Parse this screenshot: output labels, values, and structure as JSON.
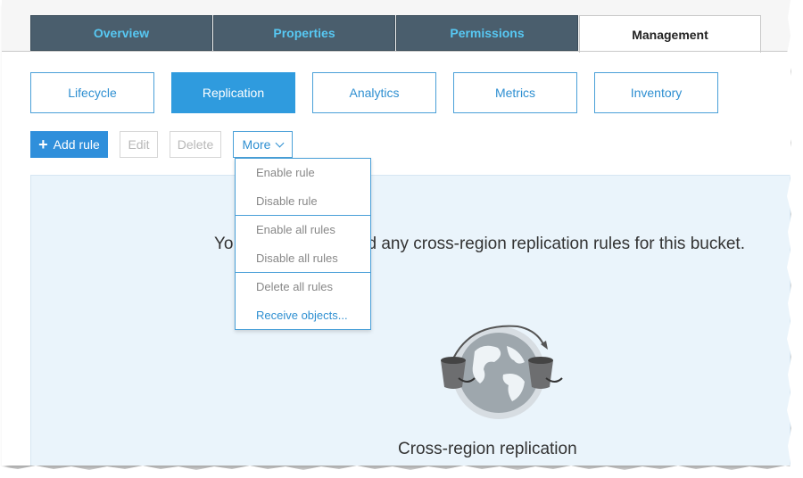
{
  "tabs": [
    {
      "label": "Overview"
    },
    {
      "label": "Properties"
    },
    {
      "label": "Permissions"
    },
    {
      "label": "Management"
    }
  ],
  "active_tab": "Management",
  "subtabs": [
    {
      "label": "Lifecycle"
    },
    {
      "label": "Replication"
    },
    {
      "label": "Analytics"
    },
    {
      "label": "Metrics"
    },
    {
      "label": "Inventory"
    }
  ],
  "active_subtab": "Replication",
  "toolbar": {
    "add_rule_label": "Add rule",
    "edit_label": "Edit",
    "delete_label": "Delete",
    "more_label": "More"
  },
  "dropdown": {
    "items": [
      {
        "label": "Enable rule"
      },
      {
        "label": "Disable rule"
      },
      {
        "label": "Enable all rules"
      },
      {
        "label": "Disable all rules"
      },
      {
        "label": "Delete all rules"
      },
      {
        "label": "Receive objects..."
      }
    ]
  },
  "empty_state": {
    "message_visible": "Yo",
    "message_rest": "d any cross-region replication rules for this bucket.",
    "caption": "Cross-region replication"
  },
  "colors": {
    "tab_bg": "#4a5e6d",
    "tab_text": "#57c8f3",
    "accent": "#2f9bde",
    "panel_bg": "#eaf4fb"
  },
  "icons": {
    "add": "plus-icon",
    "more": "chevron-down-icon",
    "illustration": "globe-replication-icon"
  }
}
